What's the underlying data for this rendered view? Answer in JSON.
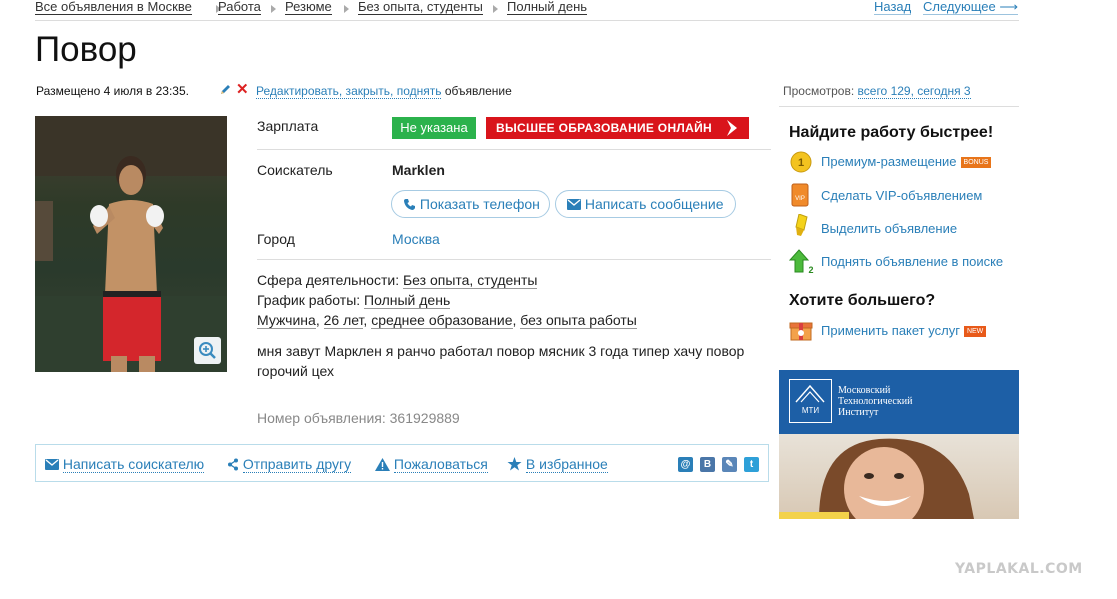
{
  "breadcrumb": [
    "Все объявления в Москве",
    "Работа",
    "Резюме",
    "Без опыта, студенты",
    "Полный день"
  ],
  "nav": {
    "back": "Назад",
    "next": "Следующее ⟶"
  },
  "title": "Повор",
  "posted": "Размещено 4 июля в 23:35.",
  "edit": {
    "links": "Редактировать, закрыть, поднять",
    "suffix": " объявление"
  },
  "views": {
    "label": "Просмотров: ",
    "value": "всего 129, сегодня 3"
  },
  "details": {
    "salary_label": "Зарплата",
    "salary_value": "Не указана",
    "ad_banner": "ВЫСШЕЕ ОБРАЗОВАНИЕ ОНЛАЙН",
    "applicant_label": "Соискатель",
    "applicant_name": "Marklen",
    "show_phone": "Показать телефон",
    "write_message": "Написать сообщение",
    "city_label": "Город",
    "city_value": "Москва",
    "field_label": "Сфера деятельности: ",
    "field_value": "Без опыта, студенты",
    "schedule_label": "График работы: ",
    "schedule_value": "Полный день",
    "attrs": [
      "Мужчина",
      "26 лет",
      "среднее образование",
      "без опыта работы"
    ],
    "description": "мня завут Маркл­ен я ранчо работал повор мясник 3 года типер хачу повор горочий цех",
    "ad_number": "Номер объявления: 361929889"
  },
  "actions": {
    "write": "Написать соискателю",
    "share": "Отправить другу",
    "complain": "Пожаловаться",
    "favorite": "В избранное"
  },
  "social": [
    "@",
    "В",
    "✎",
    "t"
  ],
  "sidebar": {
    "heading1": "Найдите работу быстрее!",
    "items": [
      {
        "label": "Премиум-размещение",
        "tag": "BONUS"
      },
      {
        "label": "Сделать VIP-объявлением",
        "tag": ""
      },
      {
        "label": "Выделить объявление",
        "tag": ""
      },
      {
        "label": "Поднять объявление в поиске",
        "tag": ""
      }
    ],
    "heading2": "Хотите большего?",
    "package": {
      "label": "Применить пакет услуг",
      "tag": "NEW"
    }
  },
  "banner": {
    "logo": "МТИ",
    "line1": "Московский",
    "line2": "Технологический",
    "line3": "Институт"
  },
  "watermark": "YAPLAKAL.COM",
  "colors": {
    "link": "#2a7fb8",
    "green": "#2bb24c",
    "red": "#d9141b",
    "banner_blue": "#1d5fa6"
  }
}
